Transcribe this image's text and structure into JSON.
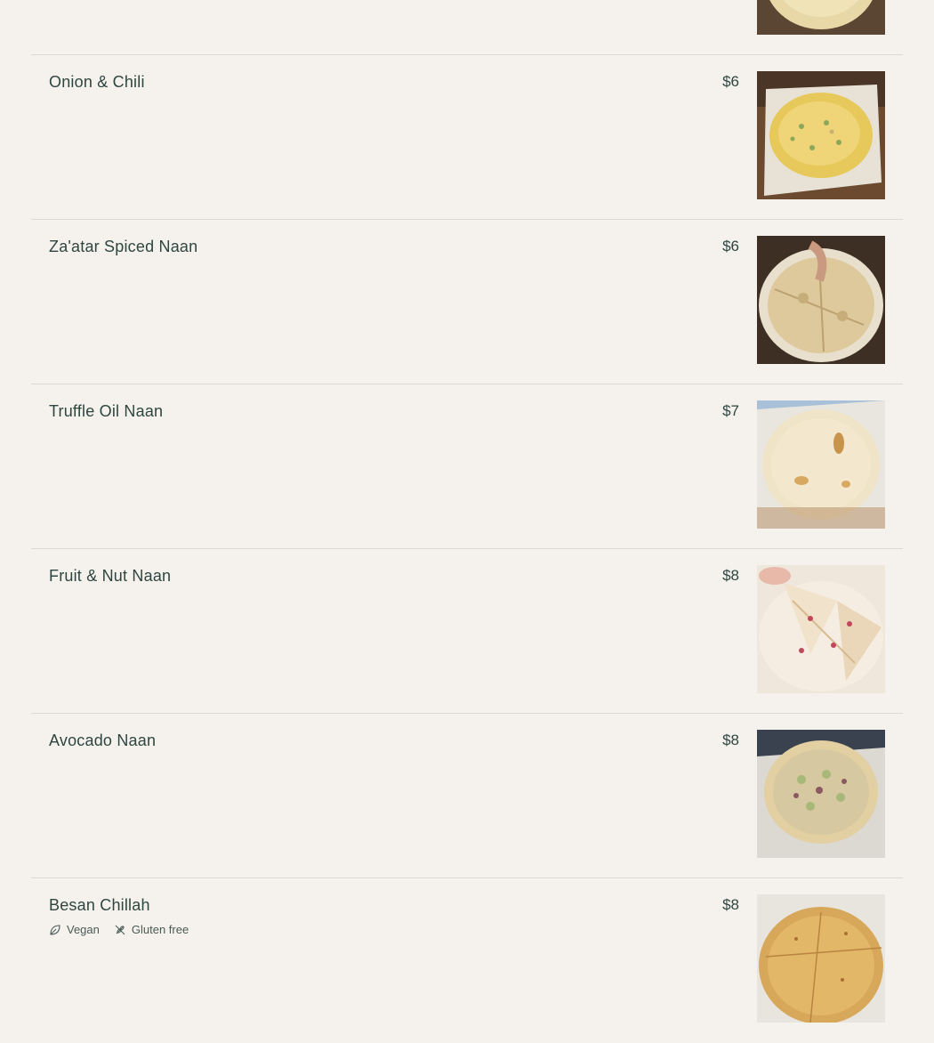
{
  "menu": {
    "items": [
      {
        "name": "",
        "price": "",
        "photo": "naan-garlic",
        "tags": []
      },
      {
        "name": "Onion & Chili",
        "price": "$6",
        "photo": "naan-onion-chili",
        "tags": []
      },
      {
        "name": "Za'atar Spiced Naan",
        "price": "$6",
        "photo": "naan-zaatar",
        "tags": []
      },
      {
        "name": "Truffle Oil Naan",
        "price": "$7",
        "photo": "naan-truffle",
        "tags": []
      },
      {
        "name": "Fruit & Nut Naan",
        "price": "$8",
        "photo": "naan-fruit-nut",
        "tags": []
      },
      {
        "name": "Avocado Naan",
        "price": "$8",
        "photo": "naan-avocado",
        "tags": []
      },
      {
        "name": "Besan Chillah",
        "price": "$8",
        "photo": "besan-chillah",
        "tags": [
          {
            "label": "Vegan",
            "icon": "leaf-icon"
          },
          {
            "label": "Gluten free",
            "icon": "no-wheat-icon"
          }
        ]
      }
    ]
  }
}
